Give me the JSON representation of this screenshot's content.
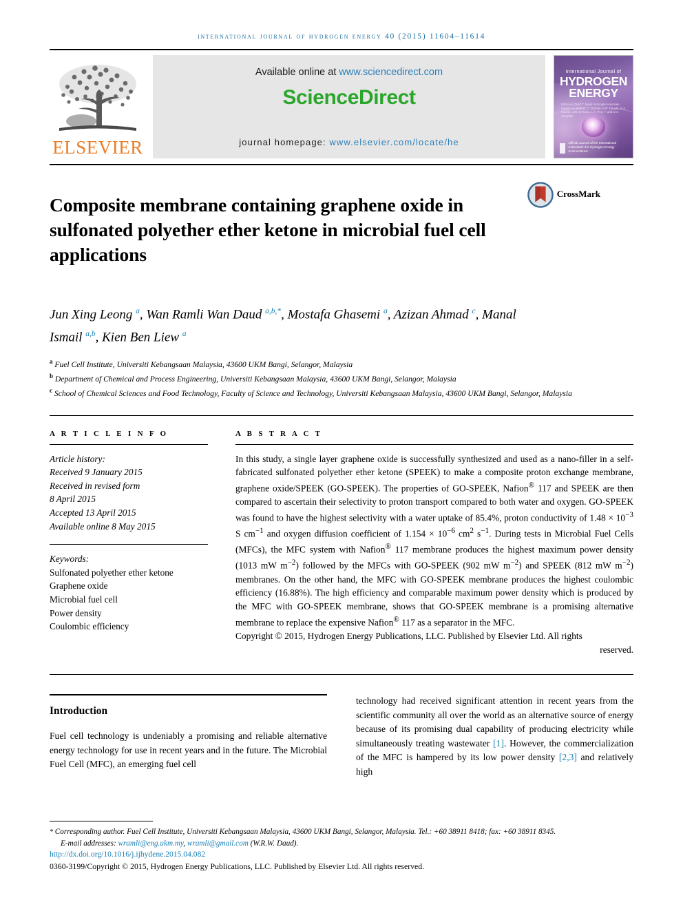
{
  "running_head": "International Journal of Hydrogen Energy 40 (2015) 11604–11614",
  "banner": {
    "publisher": "ELSEVIER",
    "available_text": "Available online at ",
    "available_url": "www.sciencedirect.com",
    "sciencedirect": "ScienceDirect",
    "homepage_label": "journal homepage: ",
    "homepage_url": "www.elsevier.com/locate/he",
    "cover": {
      "line1": "International Journal of",
      "line2": "HYDROGEN",
      "line3": "ENERGY",
      "editors": "Editor-in-Chief: T. Nejat Veziroglu   Associate Editors: A. Bartels, C. Gurban, H.R. Ukushi, R.Z. Kuchie, J.M. Bellosta, L.A. Pez, T. and D.A. Vergalas",
      "sd_mark": "Official Journal of the International Association for Hydrogen Energy  ScienceDirect"
    }
  },
  "crossmark": {
    "label": "CrossMark"
  },
  "article": {
    "title": "Composite membrane containing graphene oxide in sulfonated polyether ether ketone in microbial fuel cell applications",
    "authors_html": "Jun Xing Leong <sup>a</sup>, Wan Ramli Wan Daud <sup>a,b,*</sup>, Mostafa Ghasemi <sup>a</sup>, Azizan Ahmad <sup>c</sup>, Manal Ismail <sup>a,b</sup>, Kien Ben Liew <sup>a</sup>",
    "affiliations": [
      {
        "mark": "a",
        "text": "Fuel Cell Institute, Universiti Kebangsaan Malaysia, 43600 UKM Bangi, Selangor, Malaysia"
      },
      {
        "mark": "b",
        "text": "Department of Chemical and Process Engineering, Universiti Kebangsaan Malaysia, 43600 UKM Bangi, Selangor, Malaysia"
      },
      {
        "mark": "c",
        "text": "School of Chemical Sciences and Food Technology, Faculty of Science and Technology, Universiti Kebangsaan Malaysia, 43600 UKM Bangi, Selangor, Malaysia"
      }
    ]
  },
  "article_info": {
    "heading": "A R T I C L E   I N F O",
    "history_label": "Article history:",
    "history": [
      "Received 9 January 2015",
      "Received in revised form",
      "8 April 2015",
      "Accepted 13 April 2015",
      "Available online 8 May 2015"
    ],
    "keywords_label": "Keywords:",
    "keywords": [
      "Sulfonated polyether ether ketone",
      "Graphene oxide",
      "Microbial fuel cell",
      "Power density",
      "Coulombic efficiency"
    ]
  },
  "abstract": {
    "heading": "A B S T R A C T",
    "text_html": "In this study, a single layer graphene oxide is successfully synthesized and used as a nano-filler in a self-fabricated sulfonated polyether ether ketone (SPEEK) to make a composite proton exchange membrane, graphene oxide/SPEEK (GO-SPEEK). The properties of GO-SPEEK, Nafion<sup>&reg;</sup> 117 and SPEEK are then compared to ascertain their selectivity to proton transport compared to both water and oxygen. GO-SPEEK was found to have the highest selectivity with a water uptake of 85.4%, proton conductivity of 1.48 &times; 10<sup>&minus;3</sup> S cm<sup>&minus;1</sup> and oxygen diffusion coefficient of 1.154 &times; 10<sup>&minus;6</sup> cm<sup>2</sup> s<sup>&minus;1</sup>. During tests in Microbial Fuel Cells (MFCs), the MFC system with Nafion<sup>&reg;</sup> 117 membrane produces the highest maximum power density (1013 mW m<sup>&minus;2</sup>) followed by the MFCs with GO-SPEEK (902 mW m<sup>&minus;2</sup>) and SPEEK (812 mW m<sup>&minus;2</sup>) membranes. On the other hand, the MFC with GO-SPEEK membrane produces the highest coulombic efficiency (16.88%). The high efficiency and comparable maximum power density which is produced by the MFC with GO-SPEEK membrane, shows that GO-SPEEK membrane is a promising alternative membrane to replace the expensive Nafion<sup>&reg;</sup> 117 as a separator in the MFC.",
    "copyright_main": "Copyright &copy; 2015, Hydrogen Energy Publications, LLC. Published by Elsevier Ltd. All rights",
    "copyright_last": "reserved."
  },
  "body": {
    "intro_heading": "Introduction",
    "left_html": "Fuel cell technology is undeniably a promising and reliable alternative energy technology for use in recent years and in the future. The Microbial Fuel Cell (MFC), an emerging fuel cell",
    "right_html": "technology had received significant attention in recent years from the scientific community all over the world as an alternative source of energy because of its promising dual capability of producing electricity while simultaneously treating wastewater <a href=\"#\">[1]</a>. However, the commercialization of the MFC is hampered by its low power density <a href=\"#\">[2,3]</a> and relatively high"
  },
  "footer": {
    "corresponding_html": "<span class=\"star\">*</span> <i>Corresponding author.</i> Fuel Cell Institute, Universiti Kebangsaan Malaysia, 43600 UKM Bangi, Selangor, Malaysia. Tel.: +60 38911 8418; fax: +60 38911 8345.",
    "email_html": "E-mail addresses: <a href=\"#\">wramli@eng.ukm.my</a>, <a href=\"#\">wramli@gmail.com</a> (W.R.W. Daud).",
    "doi": "http://dx.doi.org/10.1016/j.ijhydene.2015.04.082",
    "issn_line": "0360-3199/Copyright © 2015, Hydrogen Energy Publications, LLC. Published by Elsevier Ltd. All rights reserved."
  },
  "colors": {
    "link_blue": "#1a7fb5",
    "sciencedirect_green": "#2aa62a",
    "elsevier_orange": "#ec7c26",
    "runhead_blue": "#1a6e9e"
  }
}
